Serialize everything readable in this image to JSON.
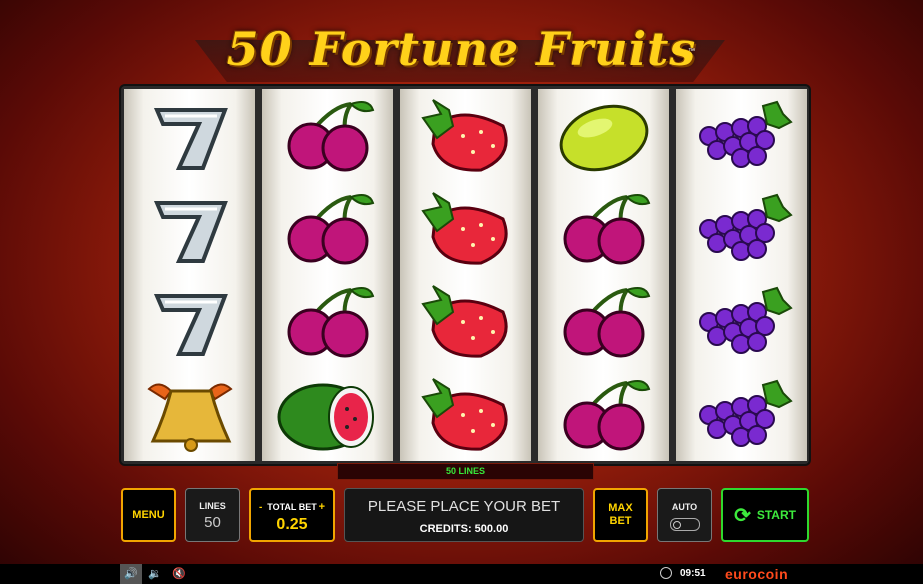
{
  "game": {
    "title": "50 Fortune Fruits",
    "trademark": "™"
  },
  "reels": [
    [
      "seven",
      "seven",
      "seven",
      "bell"
    ],
    [
      "cherry",
      "cherry",
      "cherry",
      "watermelon"
    ],
    [
      "strawberry",
      "strawberry",
      "strawberry",
      "strawberry"
    ],
    [
      "lemon",
      "cherry",
      "cherry",
      "cherry"
    ],
    [
      "grapes",
      "grapes",
      "grapes",
      "grapes"
    ]
  ],
  "lines_banner": "50 LINES",
  "controls": {
    "menu_label": "MENU",
    "lines_label": "LINES",
    "lines_value": "50",
    "total_bet_label": "TOTAL BET",
    "total_bet_value": "0.25",
    "minus": "-",
    "plus": "+",
    "message": "PLEASE PLACE YOUR BET",
    "credits": "CREDITS: 500.00",
    "max_bet_line1": "MAX",
    "max_bet_line2": "BET",
    "auto_label": "AUTO",
    "start_label": "START"
  },
  "status_bar": {
    "time": "09:51",
    "brand": "eurocoin"
  },
  "colors": {
    "accent": "#f1a500",
    "start": "#2ed82e",
    "lines_text": "#37e83a",
    "brand": "#ff4a1c"
  }
}
